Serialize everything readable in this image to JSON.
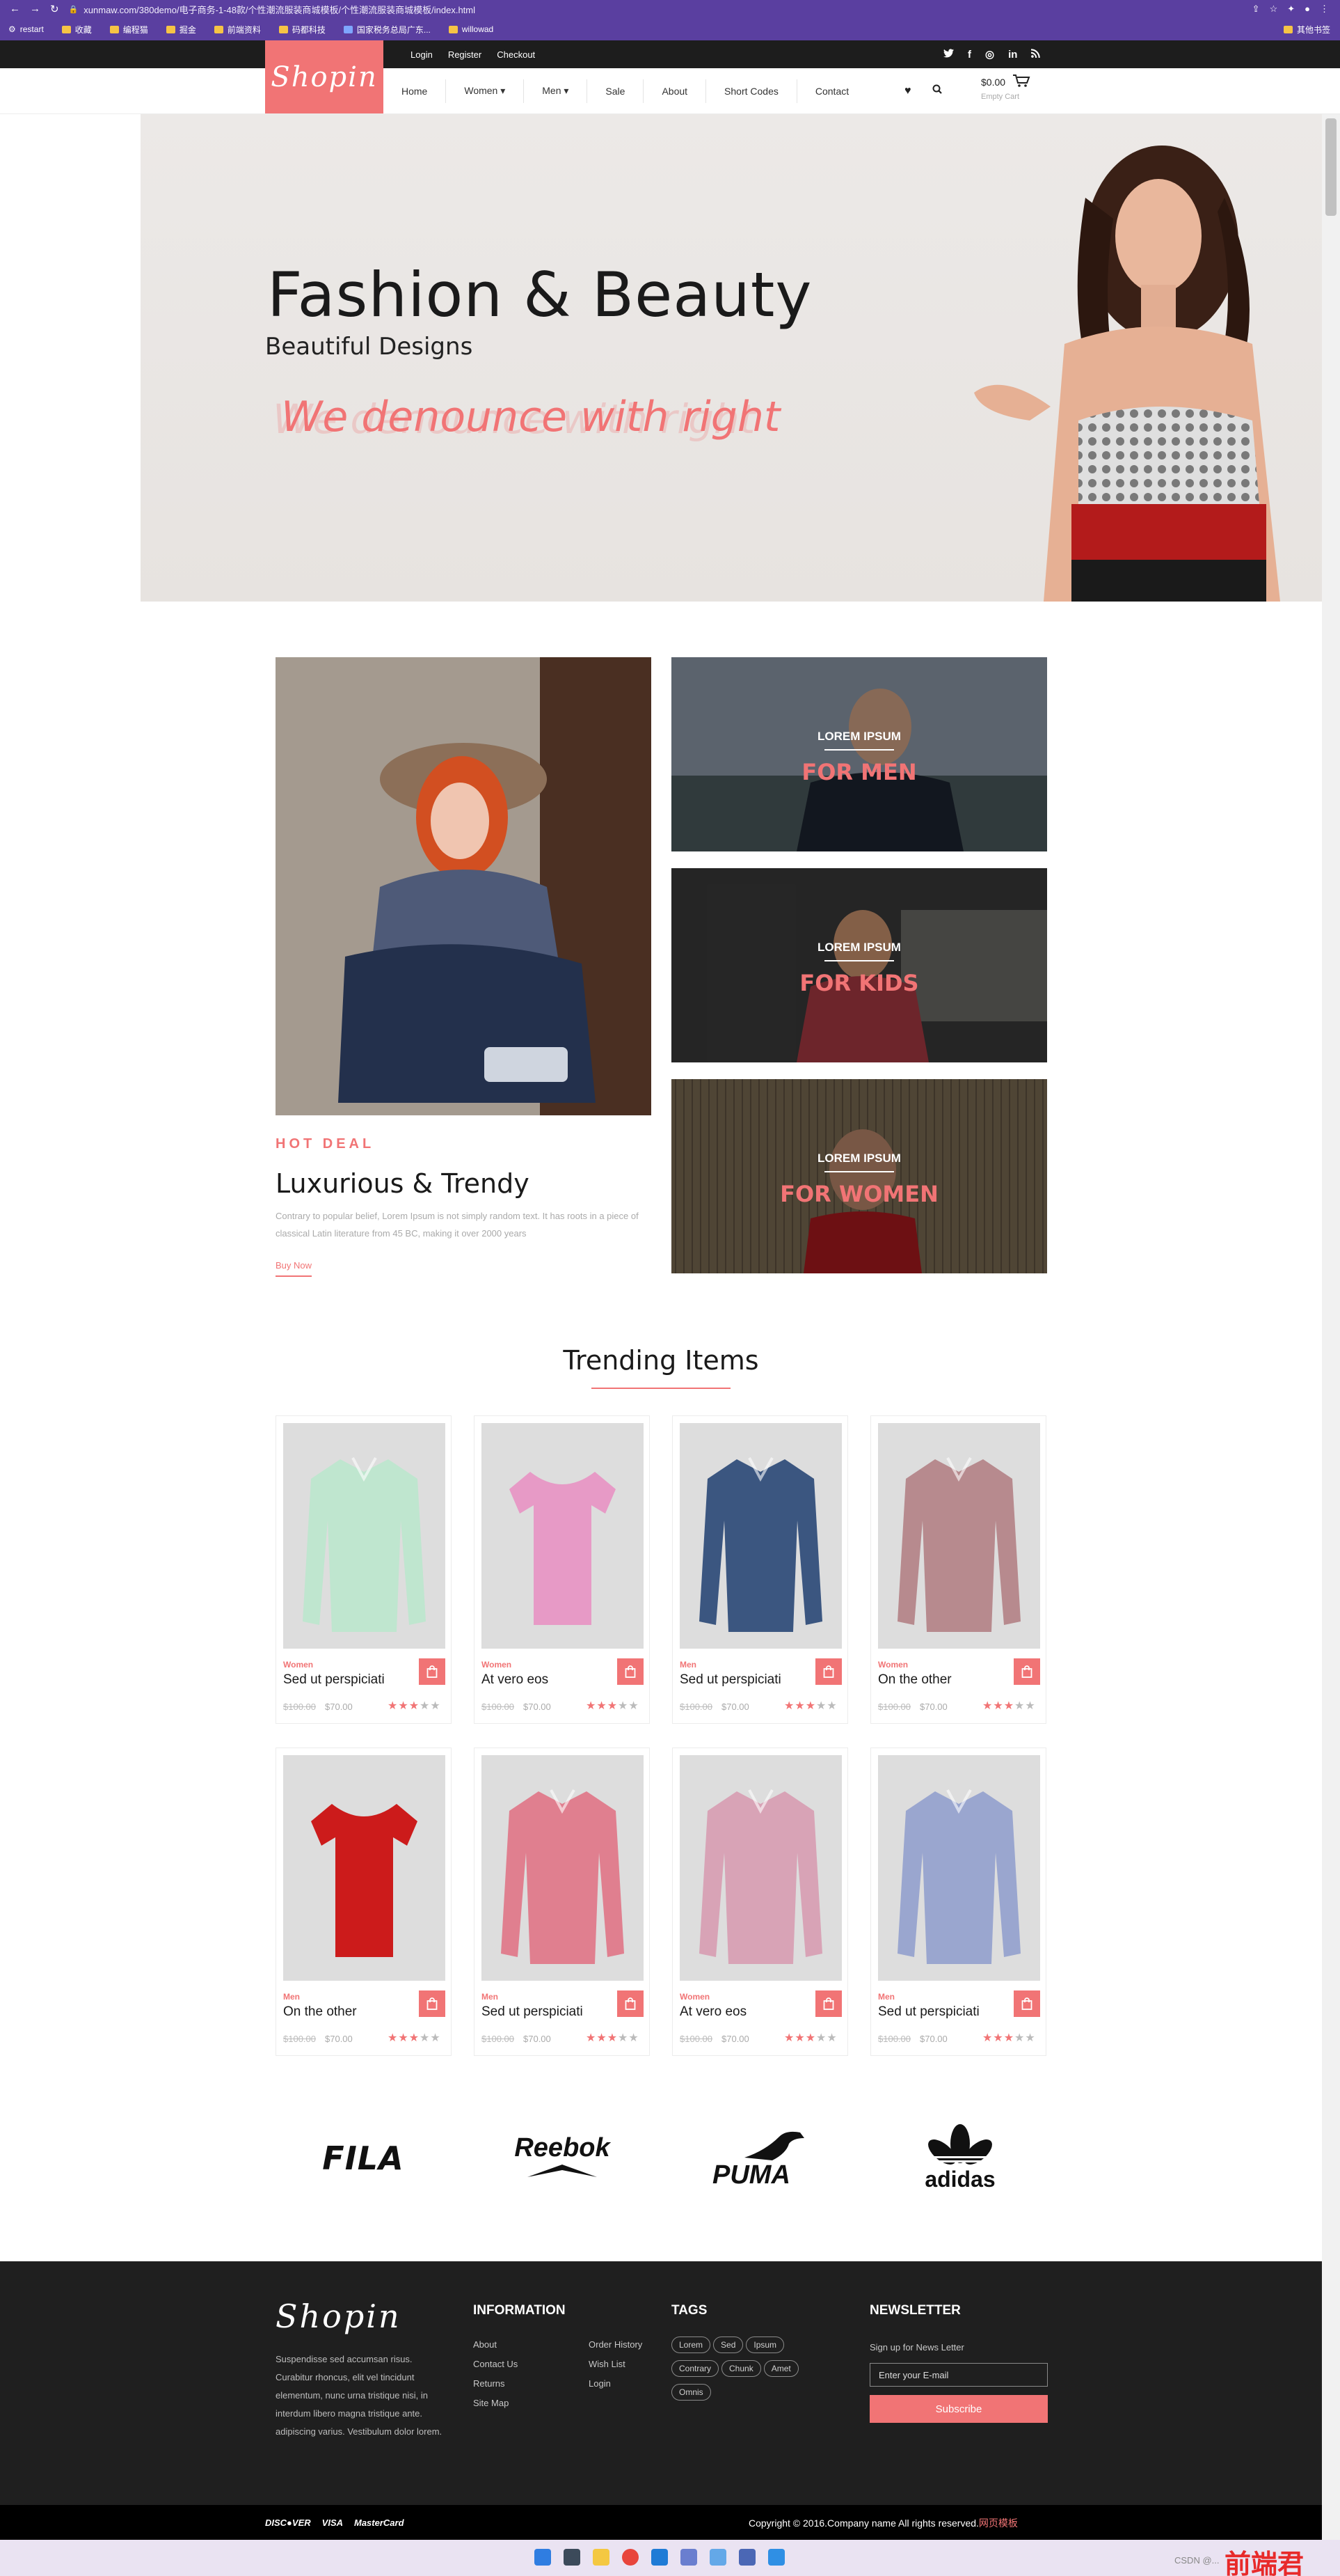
{
  "browser": {
    "url": "xunmaw.com/380demo/电子商务-1-48款/个性潮流服装商城模板/个性潮流服装商城模板/index.html",
    "bookmarks": [
      "restart",
      "收藏",
      "编程猫",
      "掘金",
      "前端资料",
      "码都科技",
      "国家税务总局广东...",
      "willowad"
    ],
    "bookmarks_right": "其他书签"
  },
  "topbar": {
    "links": [
      "Login",
      "Register",
      "Checkout"
    ],
    "social_icons": [
      "twitter-icon",
      "facebook-icon",
      "dribbble-icon",
      "linkedin-icon",
      "rss-icon"
    ]
  },
  "header": {
    "logo": "Shopin",
    "nav": [
      "Home",
      "Women ▾",
      "Men ▾",
      "Sale",
      "About",
      "Short Codes",
      "Contact"
    ],
    "cart_total": "$0.00",
    "cart_status": "Empty Cart"
  },
  "hero": {
    "title": "Fashion & Beauty",
    "subtitle": "Beautiful Designs",
    "tagline": "We denounce with right"
  },
  "promo": {
    "eyebrow": "HOT DEAL",
    "title": "Luxurious & Trendy",
    "text": "Contrary to popular belief, Lorem Ipsum is not simply random text. It has roots in a piece of classical Latin literature from 45 BC, making it over 2000 years",
    "cta": "Buy Now",
    "categories": [
      {
        "kicker": "LOREM IPSUM",
        "label": "FOR MEN"
      },
      {
        "kicker": "LOREM IPSUM",
        "label": "FOR KIDS"
      },
      {
        "kicker": "LOREM IPSUM",
        "label": "FOR WOMEN"
      }
    ]
  },
  "trending": {
    "title": "Trending Items",
    "products": [
      {
        "category": "Women",
        "name": "Sed ut perspiciati",
        "old_price": "$100.00",
        "price": "$70.00",
        "rating": 3,
        "color": "#bfe6cf"
      },
      {
        "category": "Women",
        "name": "At vero eos",
        "old_price": "$100.00",
        "price": "$70.00",
        "rating": 3,
        "color": "#e79ac6"
      },
      {
        "category": "Men",
        "name": "Sed ut perspiciati",
        "old_price": "$100.00",
        "price": "$70.00",
        "rating": 3,
        "color": "#3b5680"
      },
      {
        "category": "Women",
        "name": "On the other",
        "old_price": "$100.00",
        "price": "$70.00",
        "rating": 3,
        "color": "#b78a8e"
      },
      {
        "category": "Men",
        "name": "On the other",
        "old_price": "$100.00",
        "price": "$70.00",
        "rating": 3,
        "color": "#cc1b1b"
      },
      {
        "category": "Men",
        "name": "Sed ut perspiciati",
        "old_price": "$100.00",
        "price": "$70.00",
        "rating": 3,
        "color": "#e07f8f"
      },
      {
        "category": "Women",
        "name": "At vero eos",
        "old_price": "$100.00",
        "price": "$70.00",
        "rating": 3,
        "color": "#d8a3b6"
      },
      {
        "category": "Men",
        "name": "Sed ut perspiciati",
        "old_price": "$100.00",
        "price": "$70.00",
        "rating": 3,
        "color": "#9aa6cf"
      }
    ]
  },
  "brands": [
    "FILA",
    "Reebok",
    "PUMA",
    "adidas"
  ],
  "footer": {
    "logo": "Shopin",
    "about": "Suspendisse sed accumsan risus. Curabitur rhoncus, elit vel tincidunt elementum, nunc urna tristique nisi, in interdum libero magna tristique ante. adipiscing varius. Vestibulum dolor lorem.",
    "information_title": "INFORMATION",
    "info_col1": [
      "About",
      "Contact Us",
      "Returns",
      "Site Map"
    ],
    "info_col2": [
      "Order History",
      "Wish List",
      "Login"
    ],
    "tags_title": "TAGS",
    "tags": [
      "Lorem",
      "Sed",
      "Ipsum",
      "Contrary",
      "Chunk",
      "Amet",
      "Omnis"
    ],
    "newsletter_title": "NEWSLETTER",
    "newsletter_label": "Sign up for News Letter",
    "newsletter_placeholder": "Enter your E-mail",
    "subscribe": "Subscribe",
    "payments": [
      "DISC●VER",
      "VISA",
      "MasterCard"
    ],
    "copyright": "Copyright © 2016.Company name All rights reserved.",
    "copyright_link": "网页模板"
  },
  "taskbar": {
    "credit": "CSDN @...",
    "watermark": "前端君"
  }
}
